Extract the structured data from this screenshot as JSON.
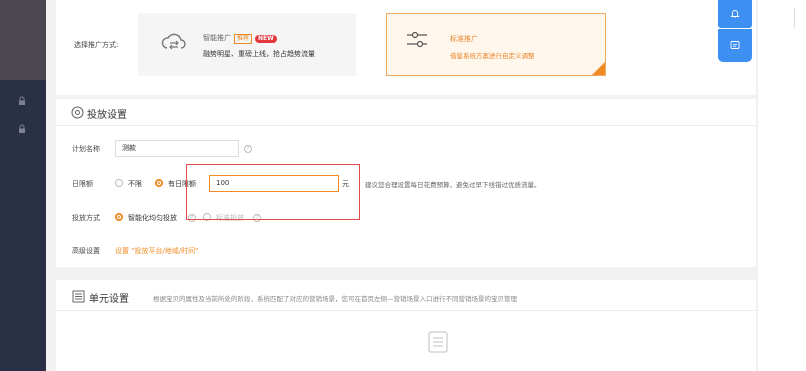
{
  "mode_section": {
    "label": "选择推广方式:",
    "smart": {
      "title": "智能推广",
      "tag_recommend": "推荐",
      "tag_new": "NEW",
      "desc": "融势明星、重磅上线，抢占趋势流量"
    },
    "standard": {
      "title": "标准推广",
      "desc": "借鉴系统方案进行自定义调整"
    }
  },
  "investment": {
    "title": "投放设置",
    "plan_name_label": "计划名称",
    "plan_name_value": "测款",
    "daily_limit_label": "日限额",
    "opt_unlimited": "不限",
    "opt_daily_limit": "有日限额",
    "budget_value": "100",
    "unit": "元",
    "tip": "建议您合理设置每日花费预算，避免过早下线错过优质流量。",
    "method_label": "投放方式",
    "method_smart": "智能化均匀投放",
    "method_standard": "标准投放",
    "advanced_label": "高级设置",
    "advanced_link": "设置 \"投放平台/地域/时间\""
  },
  "unit_section": {
    "title": "单元设置",
    "desc": "根据宝贝的属性及当前所处的阶段，系统匹配了对应的营销场景，您可在首页左侧—营销场景入口进行不同营销场景的宝贝管理"
  },
  "icons": {
    "cloud": "cloud-icon",
    "sliders": "sliders-icon",
    "settings_circle": "settings-icon",
    "list": "list-icon",
    "bell": "bell-icon",
    "chat": "chat-icon",
    "lock": "lock-icon"
  },
  "colors": {
    "accent": "#f08a24",
    "sidebar": "#2a3046",
    "fab": "#3d8ff2",
    "annotation": "#e54a4a"
  }
}
